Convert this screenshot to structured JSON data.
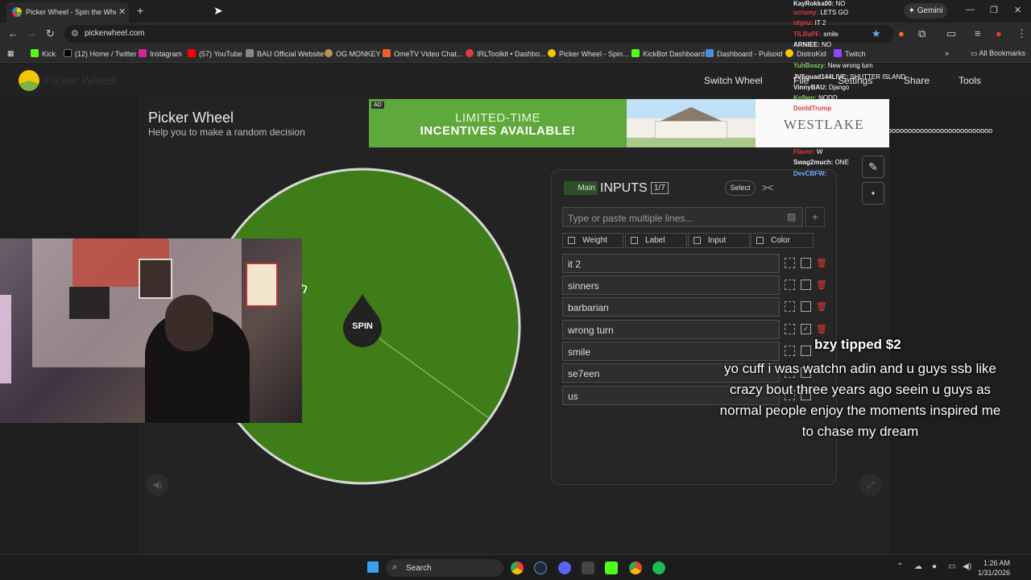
{
  "browser": {
    "tab_title": "Picker Wheel - Spin the Wheel",
    "url": "pickerwheel.com",
    "gemini_label": "Gemini",
    "bookmarks": [
      "Kick",
      "(12) Home / Twitter",
      "Instagram",
      "(57) YouTube",
      "BAU Official Website",
      "OG MONKEY",
      "OmeTV Video Chat...",
      "IRLToolkit • Dashbo...",
      "Picker Wheel - Spin...",
      "KickBot Dashboard",
      "Dashboard - Pulsoid",
      "DistroKid",
      "Twitch"
    ],
    "all_bookmarks": "All Bookmarks"
  },
  "site_header": {
    "logo_text": "Picker Wheel",
    "links": [
      "Switch Wheel",
      "File",
      "Settings",
      "Share",
      "Tools"
    ]
  },
  "page": {
    "title": "Picker Wheel",
    "subtitle": "Help you to make a random decision"
  },
  "ad": {
    "badge": "AD",
    "line1": "LIMITED-TIME",
    "line2": "INCENTIVES AVAILABLE!",
    "brand": "WESTLAKE"
  },
  "wheel": {
    "spin_label": "SPIN",
    "segment_text": "rn",
    "color": "#3f7d19"
  },
  "inputs_panel": {
    "tag": "Main",
    "title": "INPUTS",
    "count": "1/7",
    "select_label": "Select",
    "placeholder": "Type or paste multiple lines...",
    "options": [
      "Weight",
      "Label",
      "Input",
      "Color"
    ],
    "entries": [
      {
        "text": "it 2",
        "checked": false
      },
      {
        "text": "sinners",
        "checked": false
      },
      {
        "text": "barbarian",
        "checked": false
      },
      {
        "text": "wrong turn",
        "checked": true
      },
      {
        "text": "smile",
        "checked": false
      },
      {
        "text": "se7een",
        "checked": false
      },
      {
        "text": "us",
        "checked": false
      }
    ]
  },
  "chat": [
    {
      "user": "KayRokka00:",
      "msg": "NO"
    },
    {
      "user": "scrumy:",
      "msg": "LETS GO"
    },
    {
      "user": "nhjnu:",
      "msg": "IT 2"
    },
    {
      "user": "TiLRaPF:",
      "msg": "smile"
    },
    {
      "user": "ARNIEE:",
      "msg": "NO"
    },
    {
      "user": "YuhBeazy:",
      "msg": "New wrong turn"
    },
    {
      "user": "JVSquad144LIVE:",
      "msg": "SHUTTER ISLAND"
    },
    {
      "user": "VinnyBAU:",
      "msg": "Django"
    },
    {
      "user": "Kn9wn:",
      "msg": "NODD"
    },
    {
      "user": "DonldTrump",
      "msg": ""
    },
    {
      "user": "Flavor:",
      "msg": "W"
    },
    {
      "user": "Swag2much:",
      "msg": "ONE"
    },
    {
      "user": "DevCBFW:",
      "msg": ""
    }
  ],
  "tip": {
    "title": "bzy tipped $2",
    "message": "yo cuff i was watchn adin and u guys ssb like crazy bout three years ago seein u guys as normal people enjoy the moments inspired me to chase my dream"
  },
  "overlay_extra": "oooooooooooooooooooooooooo",
  "taskbar": {
    "search_label": "Search",
    "time": "1:26 AM",
    "date": "1/31/2026"
  }
}
